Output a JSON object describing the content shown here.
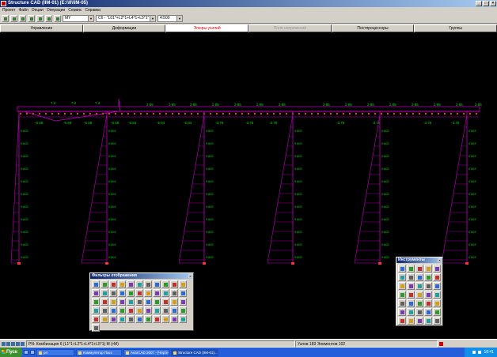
{
  "window": {
    "title": "Structure CAD (IIМ-01) (E:\\\\II\\\\IМ-05)",
    "controls": [
      "_",
      "□",
      "×"
    ]
  },
  "menu": [
    "Проект",
    "Файл",
    "Опции",
    "Операции",
    "Сервис",
    "Справка"
  ],
  "toolbar": {
    "component_value": "MY",
    "combination_value": "C6 - \"L01*+L2*1+L4*1+L5*1\"",
    "scale_value": "4:500"
  },
  "tabs": [
    {
      "label": "Управление",
      "state": "normal"
    },
    {
      "label": "Деформации",
      "state": "normal"
    },
    {
      "label": "Эпюры усилий",
      "state": "active"
    },
    {
      "label": "Поля напряжений",
      "state": "disabled"
    },
    {
      "label": "Постпроцессоры",
      "state": "normal"
    },
    {
      "label": "Группы",
      "state": "normal"
    }
  ],
  "diagram": {
    "beam_labels_top": [
      "7.2",
      "7.2",
      "7.2",
      "2.85",
      "2.85",
      "2.85",
      "2.85",
      "2.85",
      "2.85",
      "2.85",
      "2.85",
      "2.85",
      "2.85",
      "2.85",
      "2.85",
      "2.85",
      "2.85",
      "2.85"
    ],
    "beam_labels_bottom": [
      "-6.58",
      "-6.58",
      "-6.58",
      "-6.58",
      "-5.84",
      "-5.84",
      "-5.84",
      "-3.76",
      "-3.76",
      "-3.76",
      "-3.76",
      "-3.76",
      "-3.76",
      "-3.76"
    ],
    "column_value": "0.603",
    "colors": {
      "diagram": "#c000c0",
      "labels": "#00e000",
      "nodes": "#ff3030",
      "background": "#000000"
    }
  },
  "filters_panel": {
    "title": "Фильтры отображения",
    "close": "×",
    "buttons": [
      "pen-tool-icon",
      "curve-icon",
      "hook-icon",
      "magnifier-icon",
      "node-number-icon",
      "dash-icon",
      "grid-icon",
      "spring-icon",
      "bracket-icon",
      "stairs-icon",
      "axis-icon",
      "number-icon",
      "ruler-icon",
      "angle-icon",
      "frame-icon",
      "cross-icon",
      "beam-icon",
      "load-icon",
      "triangle-icon",
      "support-icon",
      "wave-icon",
      "arrow-icon",
      "hatch-icon",
      "plate-icon",
      "cube-icon",
      "arrow-down-icon",
      "list-icon",
      "tag-icon",
      "matrix-icon",
      "filter-icon",
      "brush-icon",
      "pin-icon",
      "wall-icon",
      "box-icon",
      "layers-icon",
      "diamond-icon",
      "green-arrow-icon",
      "shift-icon",
      "hinge-icon",
      "rigid-icon",
      "finger-icon",
      "beam-select-icon",
      "star-icon",
      "green-square-icon",
      "mesh-icon",
      "rod-icon",
      "fixed-icon",
      "slab-icon",
      "tool-icon",
      "sum-icon",
      "pattern-icon",
      "check-icon",
      "close-x-icon",
      "spare-icon",
      "sigma-icon",
      "frame-select-icon"
    ]
  },
  "tools_panel": {
    "title": "Инструменты",
    "close": "×",
    "buttons": [
      "compass-icon",
      "window-icon",
      "wrench-icon",
      "gear-icon",
      "move-icon",
      "rotate-icon",
      "scale-icon",
      "mirror-icon",
      "paint-icon",
      "copy-icon",
      "magnet-icon",
      "measure-icon",
      "layer-icon",
      "plate-tool-icon",
      "node-tool-icon",
      "bolt-icon",
      "line-icon",
      "zoom-icon",
      "edit-icon",
      "erase-icon",
      "info-icon",
      "cut-icon",
      "link-icon",
      "target-icon",
      "lock-icon",
      "select-icon",
      "red-circle-icon",
      "text-tool-icon",
      "section-icon",
      "calc-icon",
      "disk-icon",
      "green-tool-icon",
      "pause-icon",
      "help-icon",
      "scale-ruler-icon"
    ]
  },
  "status": {
    "combination": "PN: Комбинация 6 (L1*1+L2*1+L4*1+L5*1) М (тМ)",
    "counts": "Узлов 183 Элементов 102"
  },
  "taskbar": {
    "start": "Пуск",
    "tasks": [
      {
        "label": "p4",
        "active": false
      },
      {
        "label": "Коммулятор Пасс",
        "active": false
      },
      {
        "label": "AutoCAD 2007 - [Черте...",
        "active": false
      },
      {
        "label": "Structure CAD (IIМ-01)...",
        "active": true
      }
    ],
    "clock": "18:41"
  }
}
